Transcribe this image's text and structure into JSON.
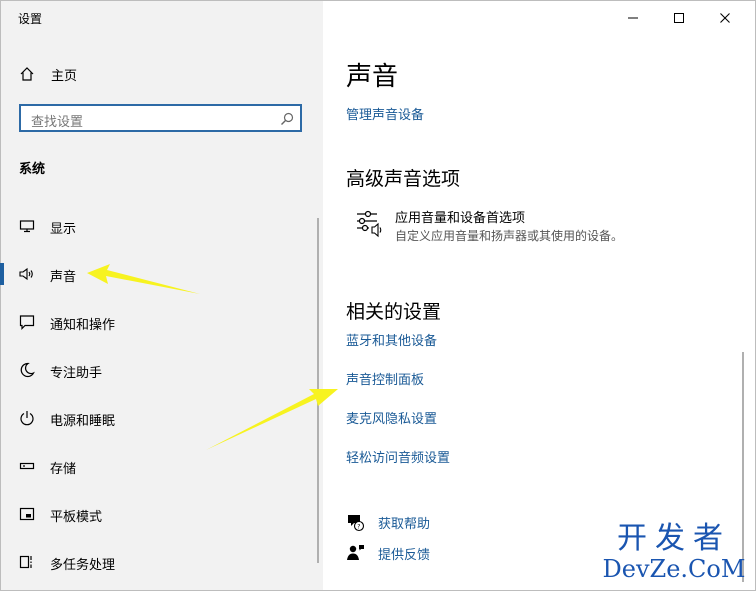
{
  "window": {
    "title": "设置"
  },
  "sidebar": {
    "home_label": "主页",
    "search_placeholder": "查找设置",
    "section_label": "系统",
    "items": [
      {
        "label": "显示",
        "icon": "monitor-icon",
        "active": false
      },
      {
        "label": "声音",
        "icon": "speaker-icon",
        "active": true
      },
      {
        "label": "通知和操作",
        "icon": "notification-icon",
        "active": false
      },
      {
        "label": "专注助手",
        "icon": "moon-icon",
        "active": false
      },
      {
        "label": "电源和睡眠",
        "icon": "power-icon",
        "active": false
      },
      {
        "label": "存储",
        "icon": "storage-icon",
        "active": false
      },
      {
        "label": "平板模式",
        "icon": "tablet-icon",
        "active": false
      },
      {
        "label": "多任务处理",
        "icon": "multitask-icon",
        "active": false
      }
    ]
  },
  "main": {
    "title": "声音",
    "manage_devices_link": "管理声音设备",
    "advanced": {
      "heading": "高级声音选项",
      "item_title": "应用音量和设备首选项",
      "item_desc": "自定义应用音量和扬声器或其使用的设备。"
    },
    "related": {
      "heading": "相关的设置",
      "links": [
        "蓝牙和其他设备",
        "声音控制面板",
        "麦克风隐私设置",
        "轻松访问音频设置"
      ]
    },
    "help": {
      "get_help": "获取帮助",
      "feedback": "提供反馈"
    }
  },
  "watermark": {
    "line1": "开发者",
    "line2": "DevZe.CoM"
  },
  "colors": {
    "accent": "#1e5fa0",
    "link": "#1a5a96",
    "arrow": "#f7f320",
    "sidebar_bg": "#f2f2f2"
  }
}
